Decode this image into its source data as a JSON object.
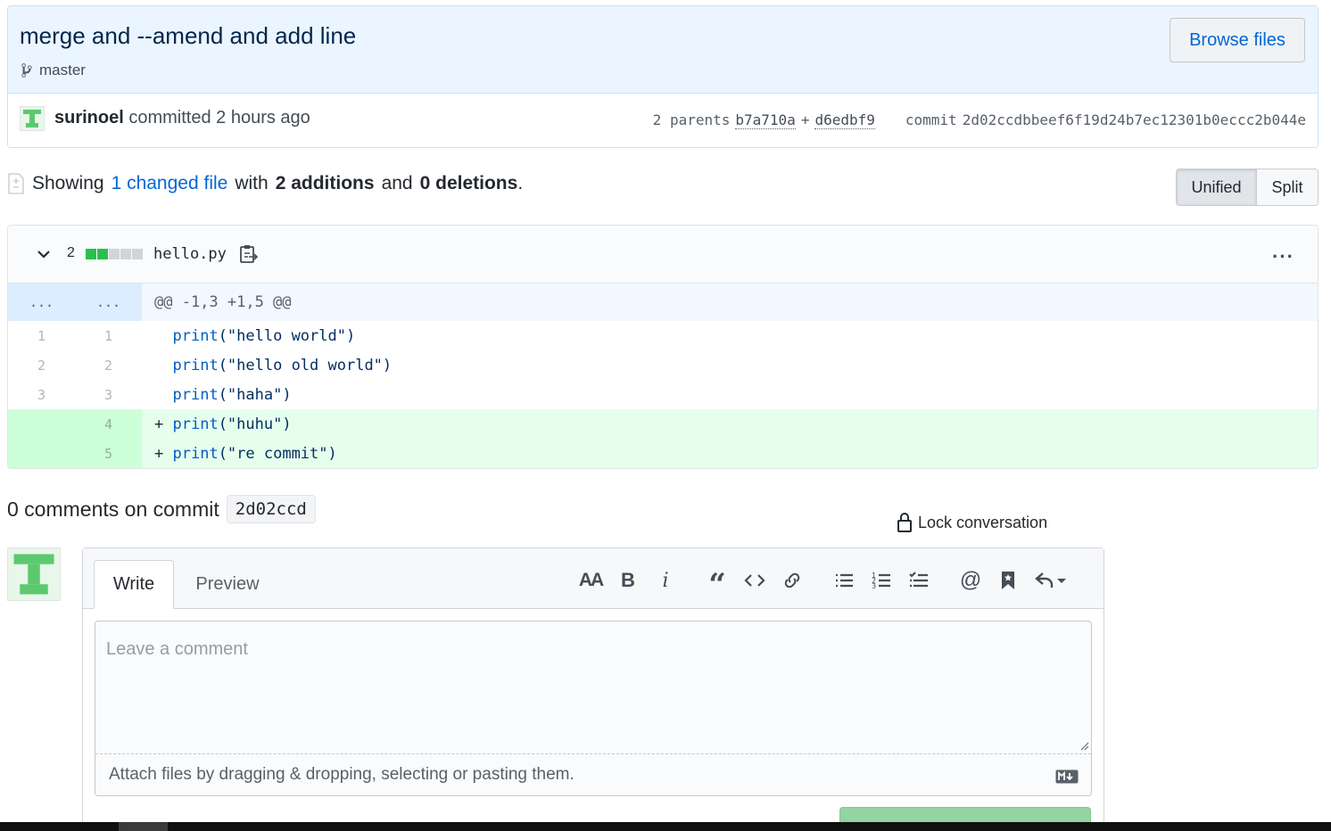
{
  "commit": {
    "title": "merge and --amend and add line",
    "branch": "master",
    "browse_files_label": "Browse files",
    "author": "surinoel",
    "committed_text": "committed 2 hours ago",
    "parents_label": "2 parents",
    "parent_1": "b7a710a",
    "parent_sep": "+",
    "parent_2": "d6edbf9",
    "commit_label": "commit",
    "commit_sha": "2d02ccdbbeef6f19d24b7ec12301b0eccc2b044e"
  },
  "toc": {
    "showing": "Showing",
    "changed_files": "1 changed file",
    "with": "with",
    "additions": "2 additions",
    "and": "and",
    "deletions": "0 deletions",
    "period": "."
  },
  "diff_view": {
    "unified_label": "Unified",
    "split_label": "Split",
    "selected": "Unified"
  },
  "file": {
    "changes_count": "2",
    "diffstat": [
      "added",
      "added",
      "neutral",
      "neutral",
      "neutral"
    ],
    "name": "hello.py",
    "more_label": "···",
    "hunk": {
      "old_ln": "...",
      "new_ln": "...",
      "header": "@@ -1,3 +1,5 @@"
    },
    "lines": [
      {
        "old": "1",
        "new": "1",
        "sign": " ",
        "fn": "print",
        "arg": "(\"hello world\")",
        "type": "context"
      },
      {
        "old": "2",
        "new": "2",
        "sign": " ",
        "fn": "print",
        "arg": "(\"hello old world\")",
        "type": "context"
      },
      {
        "old": "3",
        "new": "3",
        "sign": " ",
        "fn": "print",
        "arg": "(\"haha\")",
        "type": "context"
      },
      {
        "old": "",
        "new": "4",
        "sign": "+",
        "fn": "print",
        "arg": "(\"huhu\")",
        "type": "addition"
      },
      {
        "old": "",
        "new": "5",
        "sign": "+",
        "fn": "print",
        "arg": "(\"re commit\")",
        "type": "addition"
      }
    ]
  },
  "comments": {
    "title": "0 comments on commit",
    "short_sha": "2d02ccd",
    "lock_label": "Lock conversation"
  },
  "editor": {
    "write_tab": "Write",
    "preview_tab": "Preview",
    "placeholder": "Leave a comment",
    "attach_text": "Attach files by dragging & dropping, selecting or pasting them.",
    "toolbar_icons": [
      "text-size-icon",
      "bold-icon",
      "italic-icon",
      "quote-icon",
      "code-icon",
      "link-icon",
      "bulleted-list-icon",
      "numbered-list-icon",
      "task-list-icon",
      "mention-icon",
      "saved-reply-icon",
      "reply-icon"
    ]
  },
  "colors": {
    "accent": "#0366d6",
    "addition_bg": "#e6ffed",
    "addition_ln_bg": "#cdffd8",
    "hunk_bg": "#f1f8ff",
    "header_bg": "#eaf5ff"
  }
}
